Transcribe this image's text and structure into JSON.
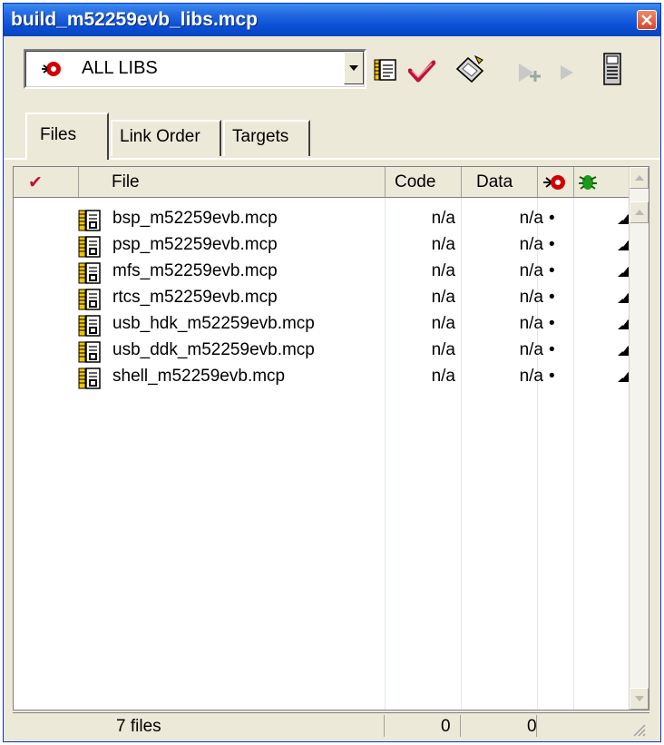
{
  "window": {
    "title": "build_m52259evb_libs.mcp"
  },
  "target": {
    "selected": "ALL LIBS"
  },
  "toolbar": {
    "icons": [
      "settings-icon",
      "check-syntax-icon",
      "make-icon",
      "debug-icon",
      "run-icon",
      "project-inspector-icon"
    ]
  },
  "tabs": [
    {
      "label": "Files",
      "active": true
    },
    {
      "label": "Link Order",
      "active": false
    },
    {
      "label": "Targets",
      "active": false
    }
  ],
  "columns": {
    "check": "✔",
    "file": "File",
    "code": "Code",
    "data": "Data"
  },
  "files": [
    {
      "name": "bsp_m52259evb.mcp",
      "code": "n/a",
      "data": "n/a",
      "dot": "•"
    },
    {
      "name": "psp_m52259evb.mcp",
      "code": "n/a",
      "data": "n/a",
      "dot": "•"
    },
    {
      "name": "mfs_m52259evb.mcp",
      "code": "n/a",
      "data": "n/a",
      "dot": "•"
    },
    {
      "name": "rtcs_m52259evb.mcp",
      "code": "n/a",
      "data": "n/a",
      "dot": "•"
    },
    {
      "name": "usb_hdk_m52259evb.mcp",
      "code": "n/a",
      "data": "n/a",
      "dot": "•"
    },
    {
      "name": "usb_ddk_m52259evb.mcp",
      "code": "n/a",
      "data": "n/a",
      "dot": "•"
    },
    {
      "name": "shell_m52259evb.mcp",
      "code": "n/a",
      "data": "n/a",
      "dot": "•"
    }
  ],
  "status": {
    "file_count": "7 files",
    "code_total": "0",
    "data_total": "0"
  },
  "colors": {
    "titlebar": "#0a4fd4",
    "chrome": "#ece9d8",
    "close": "#d7452b"
  }
}
